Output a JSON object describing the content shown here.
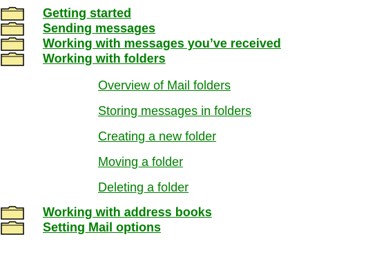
{
  "icons": {
    "folder": "folder-closed-icon"
  },
  "colors": {
    "link": "#008000",
    "folder_fill": "#f7ee9c",
    "folder_outline": "#000000"
  },
  "topics": [
    {
      "label": "Getting started"
    },
    {
      "label": "Sending messages"
    },
    {
      "label": "Working with messages you’ve received"
    },
    {
      "label": "Working with folders"
    },
    {
      "label": "Working with address books"
    },
    {
      "label": "Setting Mail options"
    }
  ],
  "subtopics": [
    {
      "label": "Overview of Mail folders"
    },
    {
      "label": "Storing messages in folders"
    },
    {
      "label": "Creating a new folder"
    },
    {
      "label": "Moving a folder"
    },
    {
      "label": "Deleting a folder"
    }
  ]
}
